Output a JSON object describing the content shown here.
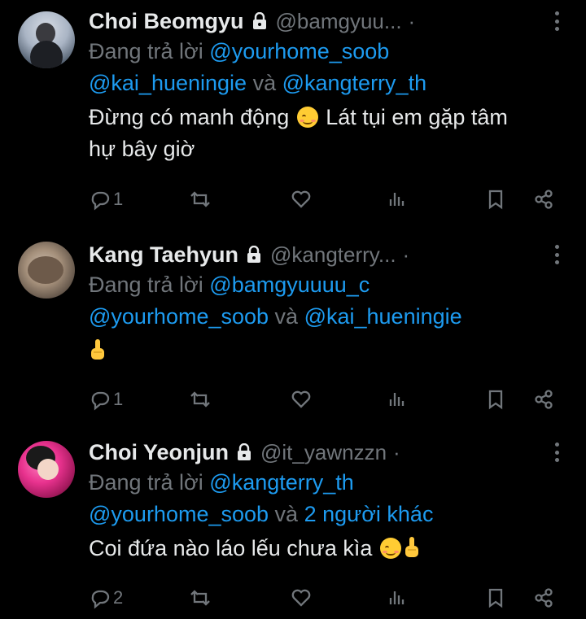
{
  "tweets": [
    {
      "name": "Choi Beomgyu",
      "handle": "@bamgyuu...",
      "dot": "·",
      "reply_prefix": "Đang trả lời",
      "reply_line1_mention": "@yourhome_soob",
      "reply_line2_a": "@kai_hueningie",
      "reply_line2_and": " và ",
      "reply_line2_b": "@kangterry_th",
      "body_line1_a": "Đừng có manh động",
      "body_line1_b": "Lát tụi em gặp tâm",
      "body_line2": "hự bây giờ",
      "reply_count": "1"
    },
    {
      "name": "Kang Taehyun",
      "handle": "@kangterry...",
      "dot": "·",
      "reply_prefix": "Đang trả lời",
      "reply_line1_mention": "@bamgyuuuu_c",
      "reply_line2_a": "@yourhome_soob",
      "reply_line2_and": " và ",
      "reply_line2_b": "@kai_hueningie",
      "reply_count": "1"
    },
    {
      "name": "Choi Yeonjun",
      "handle": "@it_yawnzzn",
      "dot": "·",
      "reply_prefix": "Đang trả lời",
      "reply_line1_mention": "@kangterry_th",
      "reply_line2_a": "@yourhome_soob",
      "reply_line2_and": " và ",
      "reply_line2_b": "2 người khác",
      "body_line1_a": "Coi đứa nào láo lếu chưa kìa",
      "reply_count": "2"
    }
  ],
  "icons": {
    "reply": "speech-bubble-icon",
    "retweet": "retweet-icon",
    "like": "heart-icon",
    "views": "bar-chart-icon",
    "bookmark": "bookmark-icon",
    "share": "share-icon",
    "lock": "lock-icon",
    "more": "more-vertical-icon"
  },
  "colors": {
    "background": "#000000",
    "text": "#e7e9ea",
    "muted": "#71767b",
    "mention": "#1d9bf0"
  }
}
